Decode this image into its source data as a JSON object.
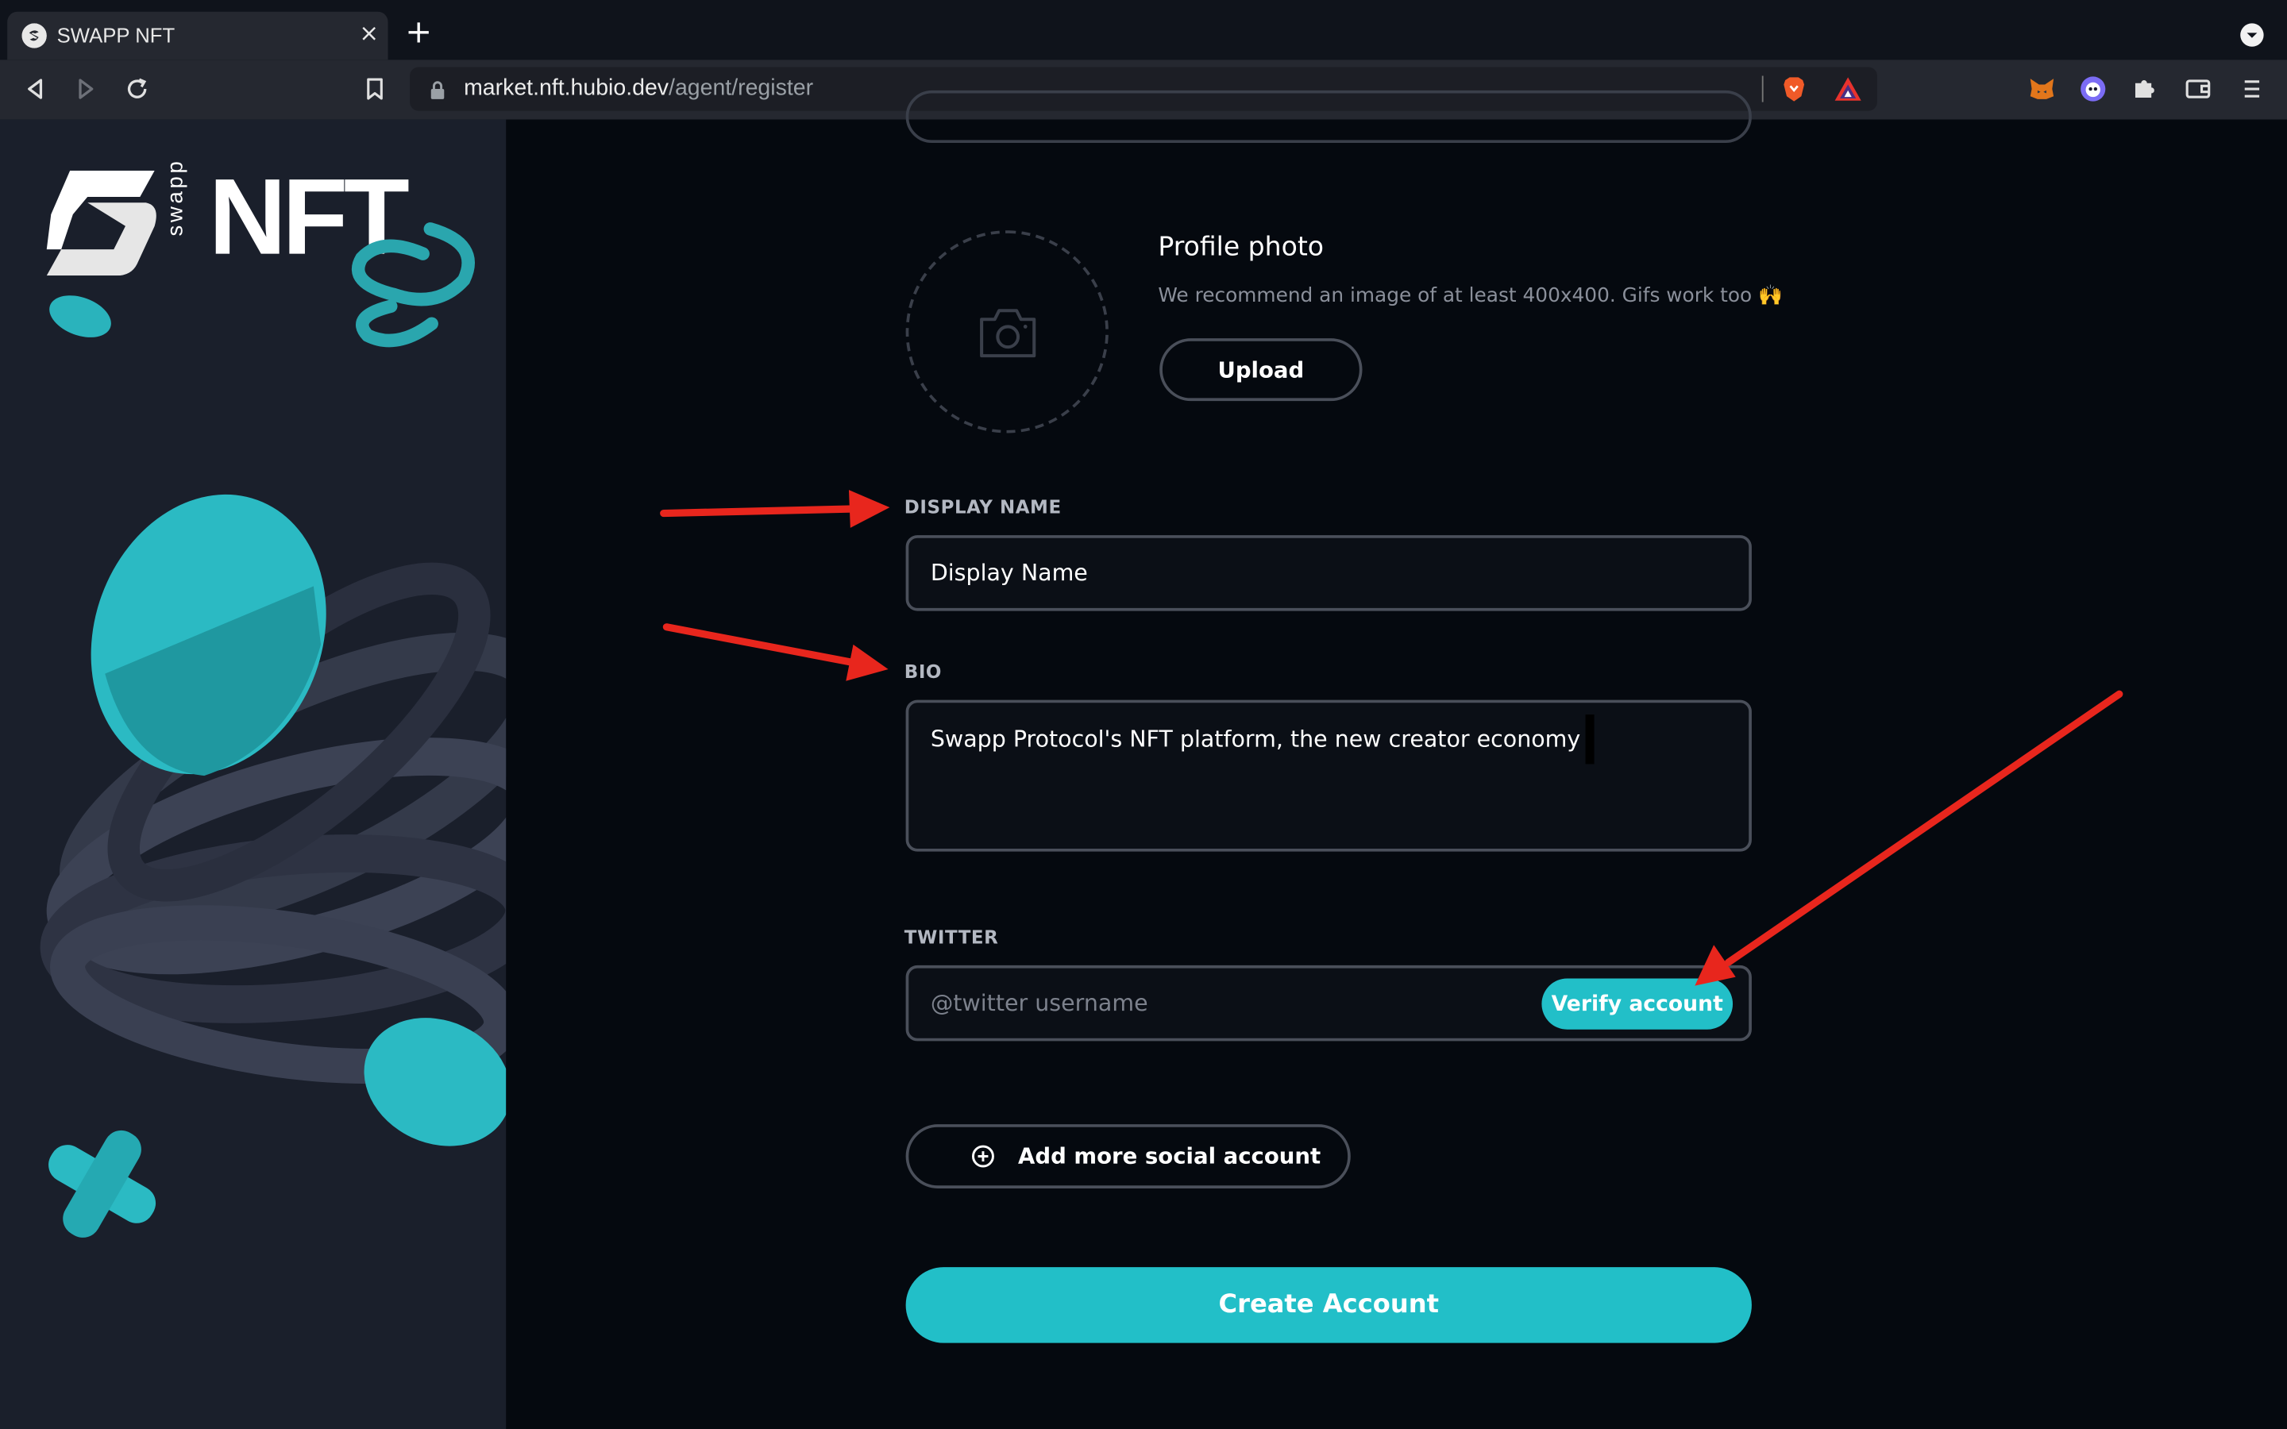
{
  "browser": {
    "tab_title": "SWAPP NFT",
    "tab_close": "×",
    "new_tab": "+",
    "url_host": "market.nft.hubio.dev",
    "url_path": "/agent/register"
  },
  "sidebar": {
    "logo_text": "NFT",
    "logo_subtext": "swapp"
  },
  "profile_photo": {
    "title": "Profile photo",
    "description": "We recommend an image of at least 400x400. Gifs work too 🙌",
    "upload_label": "Upload"
  },
  "display_name": {
    "label": "DISPLAY NAME",
    "value": "Display Name"
  },
  "bio": {
    "label": "BIO",
    "value": "Swapp Protocol's NFT platform, the new creator economy"
  },
  "twitter": {
    "label": "TWITTER",
    "placeholder": "@twitter username",
    "verify_label": "Verify account"
  },
  "social": {
    "add_label": "Add more social account"
  },
  "create_account_label": "Create Account",
  "colors": {
    "accent": "#22bfc8",
    "annotation": "#e8261d",
    "background": "#05090f",
    "sidebar": "#1a1f2b"
  }
}
